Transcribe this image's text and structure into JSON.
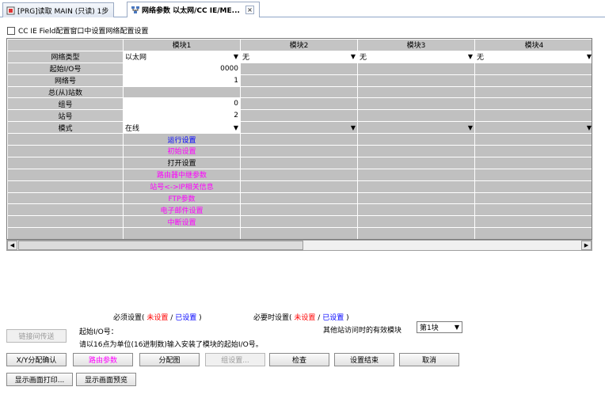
{
  "tabs": [
    {
      "label": "[PRG]读取 MAIN (只读) 1步",
      "active": false
    },
    {
      "label": "网络参数 以太网/CC IE/ME...",
      "active": true,
      "close": "×"
    }
  ],
  "option": {
    "label": "CC IE Field配置窗口中设置网络配置设置"
  },
  "grid": {
    "headers": [
      "模块1",
      "模块2",
      "模块3",
      "模块4"
    ],
    "row_labels": [
      "网络类型",
      "起始I/O号",
      "网络号",
      "总(从)站数",
      "组号",
      "站号",
      "模式"
    ],
    "module1": {
      "network_type": "以太网",
      "start_io": "0000",
      "network_no": "1",
      "group_no": "0",
      "station_no": "2",
      "mode": "在线"
    },
    "module2": {
      "network_type": "无"
    },
    "module3": {
      "network_type": "无"
    },
    "module4": {
      "network_type": "无"
    },
    "links": [
      {
        "label": "运行设置",
        "color": "blue"
      },
      {
        "label": "初始设置",
        "color": "magenta"
      },
      {
        "label": "打开设置",
        "color": "black"
      },
      {
        "label": "路由器中继参数",
        "color": "magenta"
      },
      {
        "label": "站号<->IP相关信息",
        "color": "magenta"
      },
      {
        "label": "FTP参数",
        "color": "magenta"
      },
      {
        "label": "电子邮件设置",
        "color": "magenta"
      },
      {
        "label": "中断设置",
        "color": "magenta"
      }
    ]
  },
  "legend": {
    "required_prefix": "必须设置(",
    "required_unset": "未设置",
    "sep": "/",
    "required_set": "已设置",
    "required_suffix": ")",
    "optional_prefix": "必要时设置(",
    "optional_unset": "未设置",
    "optional_set": "已设置",
    "optional_suffix": ")"
  },
  "info": {
    "start_io_label": "起始I/O号：",
    "hint": "请以16点为单位(16进制数)输入安装了模块的起始I/O号。",
    "valid_module_label": "其他站访问时的有效模块",
    "valid_module_value": "第1块"
  },
  "buttons": {
    "link_transfer": "链接间传送",
    "xy_assign": "X/Y分配确认",
    "routing": "路由参数",
    "assign_image": "分配图",
    "group_settings": "组设置...",
    "check": "检查",
    "setting_end": "设置结束",
    "cancel": "取消",
    "print": "显示画面打印...",
    "preview": "显示画面预览"
  }
}
